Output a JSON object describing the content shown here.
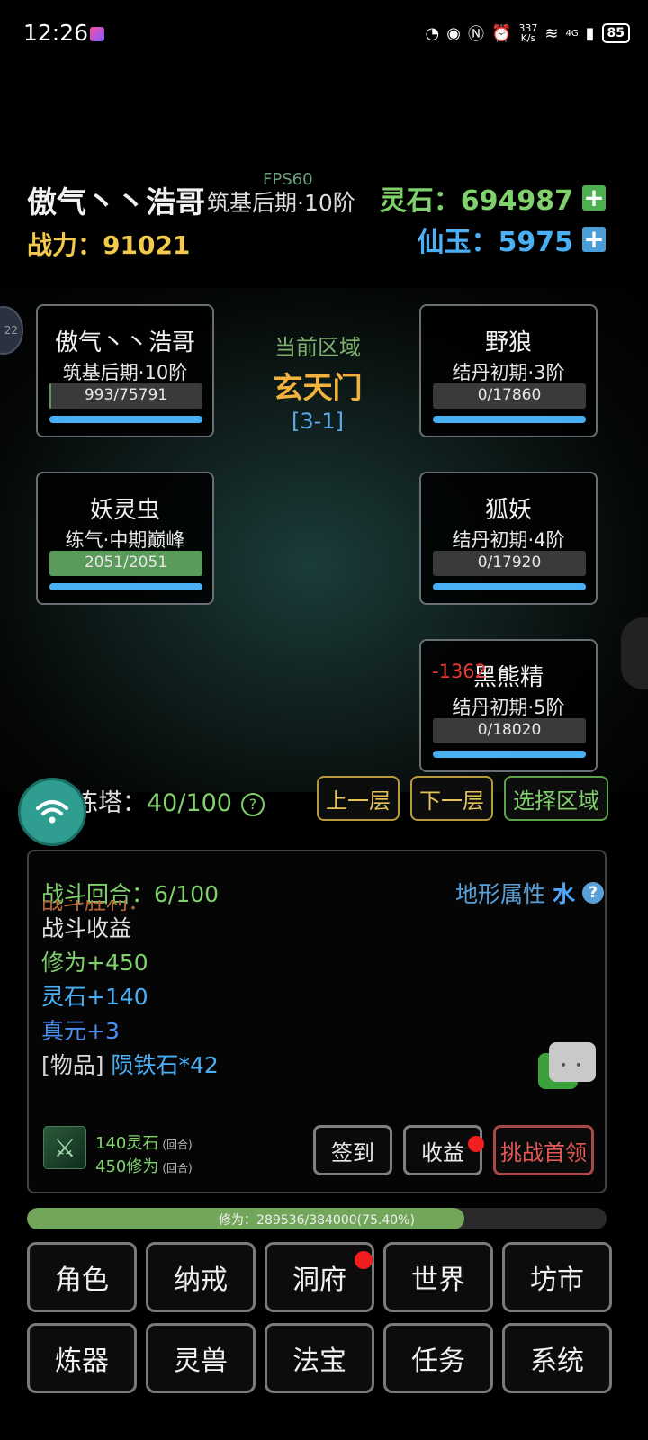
{
  "status_bar": {
    "time": "12:26",
    "net_speed_top": "337",
    "net_speed_unit": "K/s",
    "signal_tag": "4G",
    "battery": "85"
  },
  "header": {
    "player_name": "傲气丶丶浩哥",
    "player_realm": "筑基后期·10阶",
    "fps": "FPS60",
    "power_label": "战力：91021",
    "spirit_stone_label": "灵石：694987",
    "jade_label": "仙玉：5975",
    "colors": {
      "power": "#f2c94c",
      "stone": "#7fd16b",
      "jade": "#4ab0f5"
    }
  },
  "zone": {
    "label": "当前区域",
    "name": "玄天门",
    "code": "[3-1]"
  },
  "allies": [
    {
      "name": "傲气丶丶浩哥",
      "realm": "筑基后期·10阶",
      "hp_text": "993/75791",
      "hp_frac": 0.013
    },
    {
      "name": "妖灵虫",
      "realm": "练气·中期巅峰",
      "hp_text": "2051/2051",
      "hp_frac": 1.0
    }
  ],
  "enemies": [
    {
      "name": "野狼",
      "realm": "结丹初期·3阶",
      "hp_text": "0/17860",
      "hp_frac": 0
    },
    {
      "name": "狐妖",
      "realm": "结丹初期·4阶",
      "hp_text": "0/17920",
      "hp_frac": 0
    },
    {
      "name": "黑熊精",
      "realm": "结丹初期·5阶",
      "hp_text": "0/18020",
      "hp_frac": 0,
      "damage": "-1362"
    }
  ],
  "tower": {
    "label": "锁妖塔：",
    "value": "40/100",
    "help": "?"
  },
  "tower_visible_label": "炼塔：",
  "nav": {
    "prev": "上一层",
    "next": "下一层",
    "select": "选择区域"
  },
  "battle": {
    "round": "战斗回合：6/100",
    "terrain_label": "地形属性",
    "terrain_value": "水",
    "clipped_line": "战斗胜利：",
    "rewards_title": "战斗收益",
    "lines": [
      {
        "text": "修为+450",
        "color": "#7fd16b"
      },
      {
        "text": "灵石+140",
        "color": "#4ab0f5"
      },
      {
        "text": "真元+3",
        "color": "#4a8ff5"
      }
    ],
    "item_prefix": "[物品]",
    "item_name": "陨铁石*42",
    "rate_stone": "140灵石",
    "rate_exp": "450修为",
    "rate_unit": "(回合)",
    "btn_signin": "签到",
    "btn_income": "收益",
    "btn_challenge": "挑战首领"
  },
  "exp": {
    "text": "修为：289536/384000(75.40%)",
    "frac": 0.754
  },
  "menu": [
    {
      "label": "角色"
    },
    {
      "label": "纳戒"
    },
    {
      "label": "洞府",
      "dot": true
    },
    {
      "label": "世界"
    },
    {
      "label": "坊市"
    },
    {
      "label": "炼器"
    },
    {
      "label": "灵兽"
    },
    {
      "label": "法宝"
    },
    {
      "label": "任务"
    },
    {
      "label": "系统"
    }
  ]
}
